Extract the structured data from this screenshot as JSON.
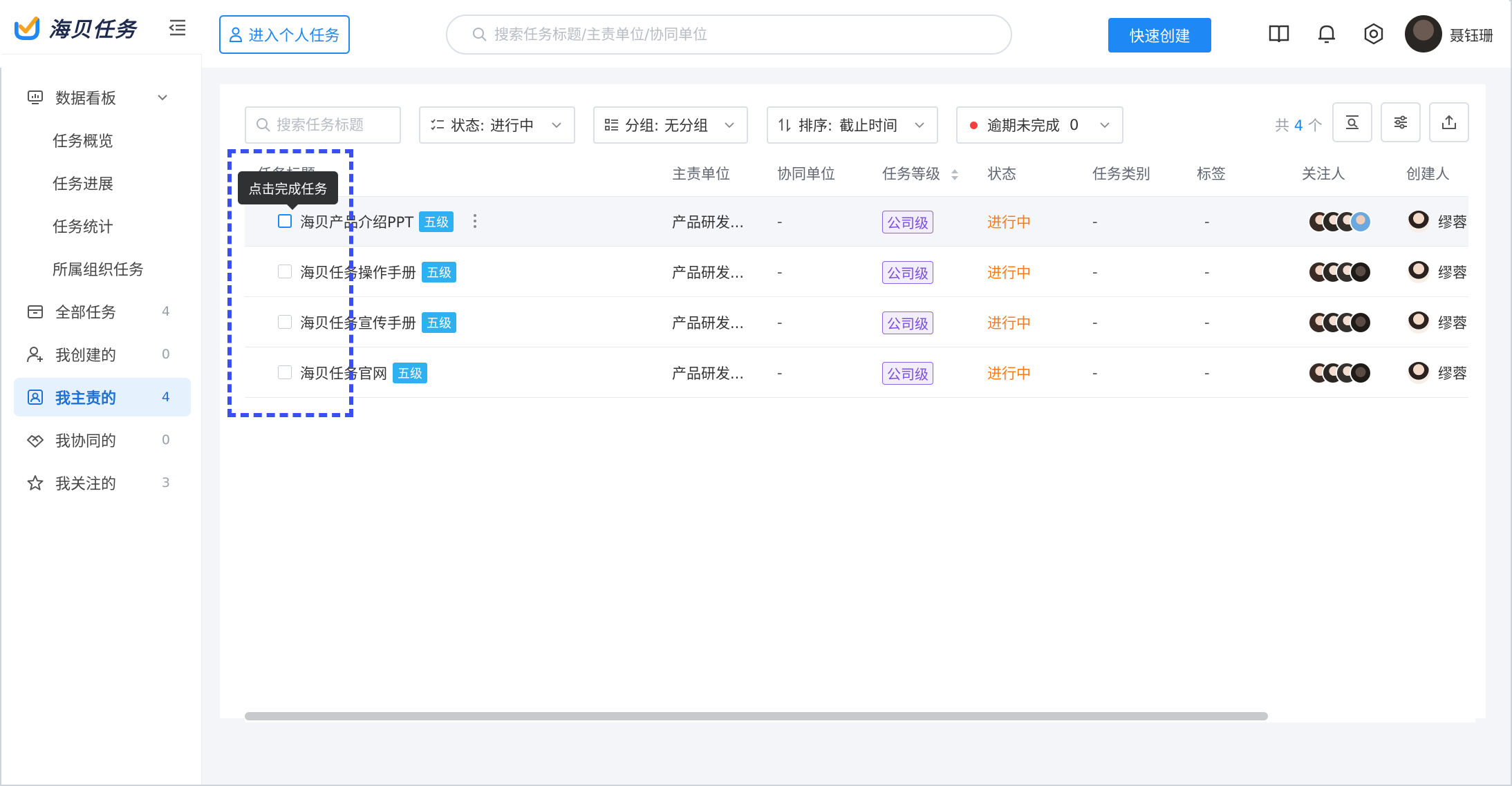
{
  "brand": {
    "name": "海贝任务",
    "accent": "#1e88f5"
  },
  "header": {
    "personal_btn": "进入个人任务",
    "search_placeholder": "搜索任务标题/主责单位/协同单位",
    "quick_create": "快速创建",
    "user_name": "聂钰珊",
    "icons": [
      "book-icon",
      "bell-icon",
      "settings-icon"
    ]
  },
  "sidebar": {
    "dashboard": "数据看板",
    "sub_items": [
      "任务概览",
      "任务进展",
      "任务统计",
      "所属组织任务"
    ],
    "items": [
      {
        "label": "全部任务",
        "count": "4",
        "icon": "inbox-icon"
      },
      {
        "label": "我创建的",
        "count": "0",
        "icon": "user-add-icon"
      },
      {
        "label": "我主责的",
        "count": "4",
        "icon": "user-card-icon",
        "active": true
      },
      {
        "label": "我协同的",
        "count": "0",
        "icon": "handshake-icon"
      },
      {
        "label": "我关注的",
        "count": "3",
        "icon": "star-icon"
      }
    ]
  },
  "filters": {
    "search_placeholder": "搜索任务标题",
    "status": "状态:",
    "status_value": "进行中",
    "group": "分组:",
    "group_value": "无分组",
    "sort": "排序:",
    "sort_value": "截止时间",
    "overdue": "逾期未完成",
    "overdue_count": "0",
    "total_prefix": "共",
    "total_count": "4",
    "total_suffix": "个"
  },
  "table": {
    "columns": [
      "任务标题",
      "主责单位",
      "协同单位",
      "任务等级",
      "状态",
      "任务类别",
      "标签",
      "关注人",
      "创建人"
    ],
    "rows": [
      {
        "title": "海贝产品介绍PPT",
        "level": "五级",
        "unit": "产品研发...",
        "co_unit": "-",
        "grade": "公司级",
        "status": "进行中",
        "category": "-",
        "tag": "-",
        "creator": "缪蓉"
      },
      {
        "title": "海贝任务操作手册",
        "level": "五级",
        "unit": "产品研发...",
        "co_unit": "-",
        "grade": "公司级",
        "status": "进行中",
        "category": "-",
        "tag": "-",
        "creator": "缪蓉"
      },
      {
        "title": "海贝任务宣传手册",
        "level": "五级",
        "unit": "产品研发...",
        "co_unit": "-",
        "grade": "公司级",
        "status": "进行中",
        "category": "-",
        "tag": "-",
        "creator": "缪蓉"
      },
      {
        "title": "海贝任务官网",
        "level": "五级",
        "unit": "产品研发...",
        "co_unit": "-",
        "grade": "公司级",
        "status": "进行中",
        "category": "-",
        "tag": "-",
        "creator": "缪蓉"
      }
    ]
  },
  "tooltip": "点击完成任务"
}
